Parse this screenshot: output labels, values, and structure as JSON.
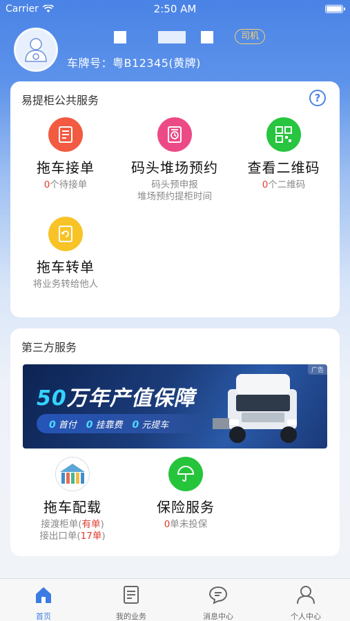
{
  "status_bar": {
    "carrier": "Carrier",
    "time": "2:50 AM"
  },
  "profile": {
    "role_badge": "司机",
    "plate": "车牌号：粤B12345(黄牌)"
  },
  "public_services": {
    "title": "易提柜公共服务",
    "help_icon": "question-circle-icon",
    "items": [
      {
        "title": "拖车接单",
        "sub_count": "0",
        "sub_text": "个待接单",
        "icon": "document-icon",
        "color": "#f25a41"
      },
      {
        "title": "码头堆场预约",
        "sub_line1": "码头预申报",
        "sub_line2": "堆场预约提柜时间",
        "icon": "clock-doc-icon",
        "color": "#ec4a86"
      },
      {
        "title": "查看二维码",
        "sub_count": "0",
        "sub_text": "个二维码",
        "icon": "qr-code-icon",
        "color": "#27c540"
      },
      {
        "title": "拖车转单",
        "sub_line1": "将业务转给他人",
        "icon": "transfer-doc-icon",
        "color": "#f7c327"
      }
    ]
  },
  "third_party": {
    "title": "第三方服务",
    "banner": {
      "ad_tag": "广告",
      "headline_num": "50",
      "headline_text": "万年产值保障",
      "perks": [
        {
          "n": "0",
          "t": "首付"
        },
        {
          "n": "0",
          "t": "挂靠费"
        },
        {
          "n": "0",
          "t": "元提车"
        }
      ]
    },
    "items": [
      {
        "title": "拖车配载",
        "line1_prefix": "接渡柜单(",
        "line1_highlight": "有单",
        "line1_suffix": ")",
        "line2_prefix": "接出口单(",
        "line2_highlight": "17单",
        "line2_suffix": ")"
      },
      {
        "title": "保险服务",
        "count": "0",
        "text": "单未投保",
        "color": "#26c43b"
      }
    ]
  },
  "tabbar": {
    "tabs": [
      {
        "label": "首页",
        "icon": "home-icon",
        "active": true
      },
      {
        "label": "我的业务",
        "icon": "business-icon"
      },
      {
        "label": "消息中心",
        "icon": "message-icon"
      },
      {
        "label": "个人中心",
        "icon": "person-icon"
      }
    ]
  },
  "colors": {
    "primary": "#4a83e6",
    "badge": "#f6d46a",
    "highlight": "#e03a2c"
  }
}
